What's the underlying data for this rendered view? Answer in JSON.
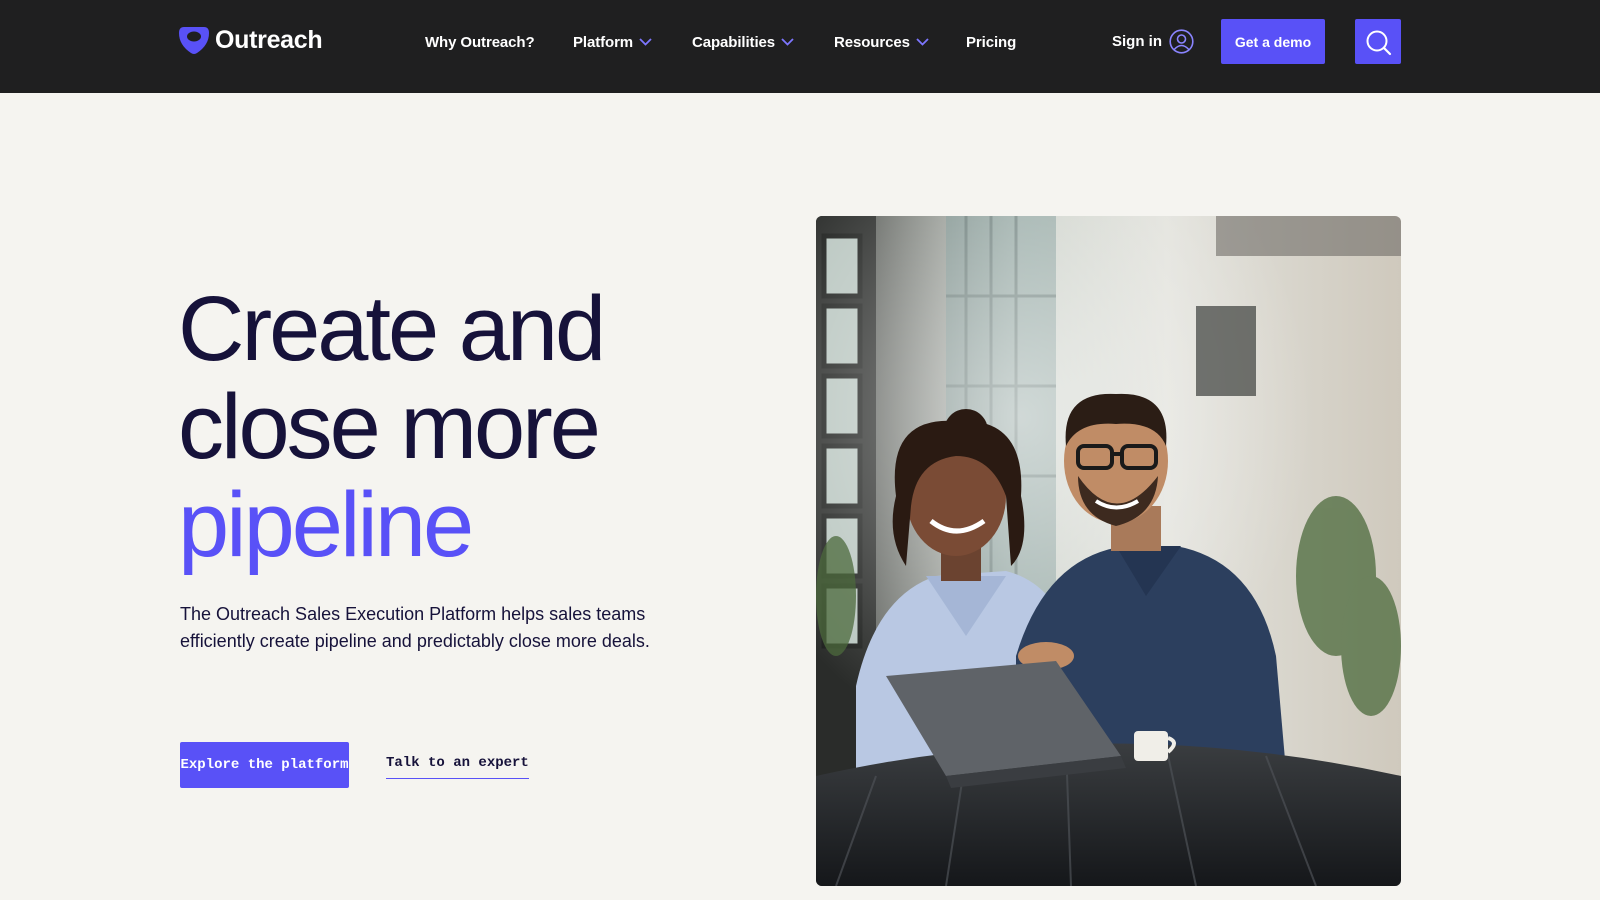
{
  "brand": {
    "name": "Outreach",
    "accent_color": "#5951f7",
    "nav_background": "#1f1f20",
    "heading_color": "#16123a"
  },
  "nav": {
    "items": [
      {
        "label": "Why Outreach?",
        "has_dropdown": false
      },
      {
        "label": "Platform",
        "has_dropdown": true
      },
      {
        "label": "Capabilities",
        "has_dropdown": true
      },
      {
        "label": "Resources",
        "has_dropdown": true
      },
      {
        "label": "Pricing",
        "has_dropdown": false
      }
    ],
    "sign_in_label": "Sign in",
    "demo_label": "Get a demo",
    "search_icon": "search-icon"
  },
  "hero": {
    "headline_line1": "Create and",
    "headline_line2": "close more",
    "headline_accent": "pipeline",
    "subtext_line1": "The Outreach Sales Execution Platform helps sales teams",
    "subtext_line2": "efficiently create pipeline and predictably close more deals.",
    "primary_cta": "Explore the platform",
    "secondary_cta": "Talk to an expert"
  }
}
